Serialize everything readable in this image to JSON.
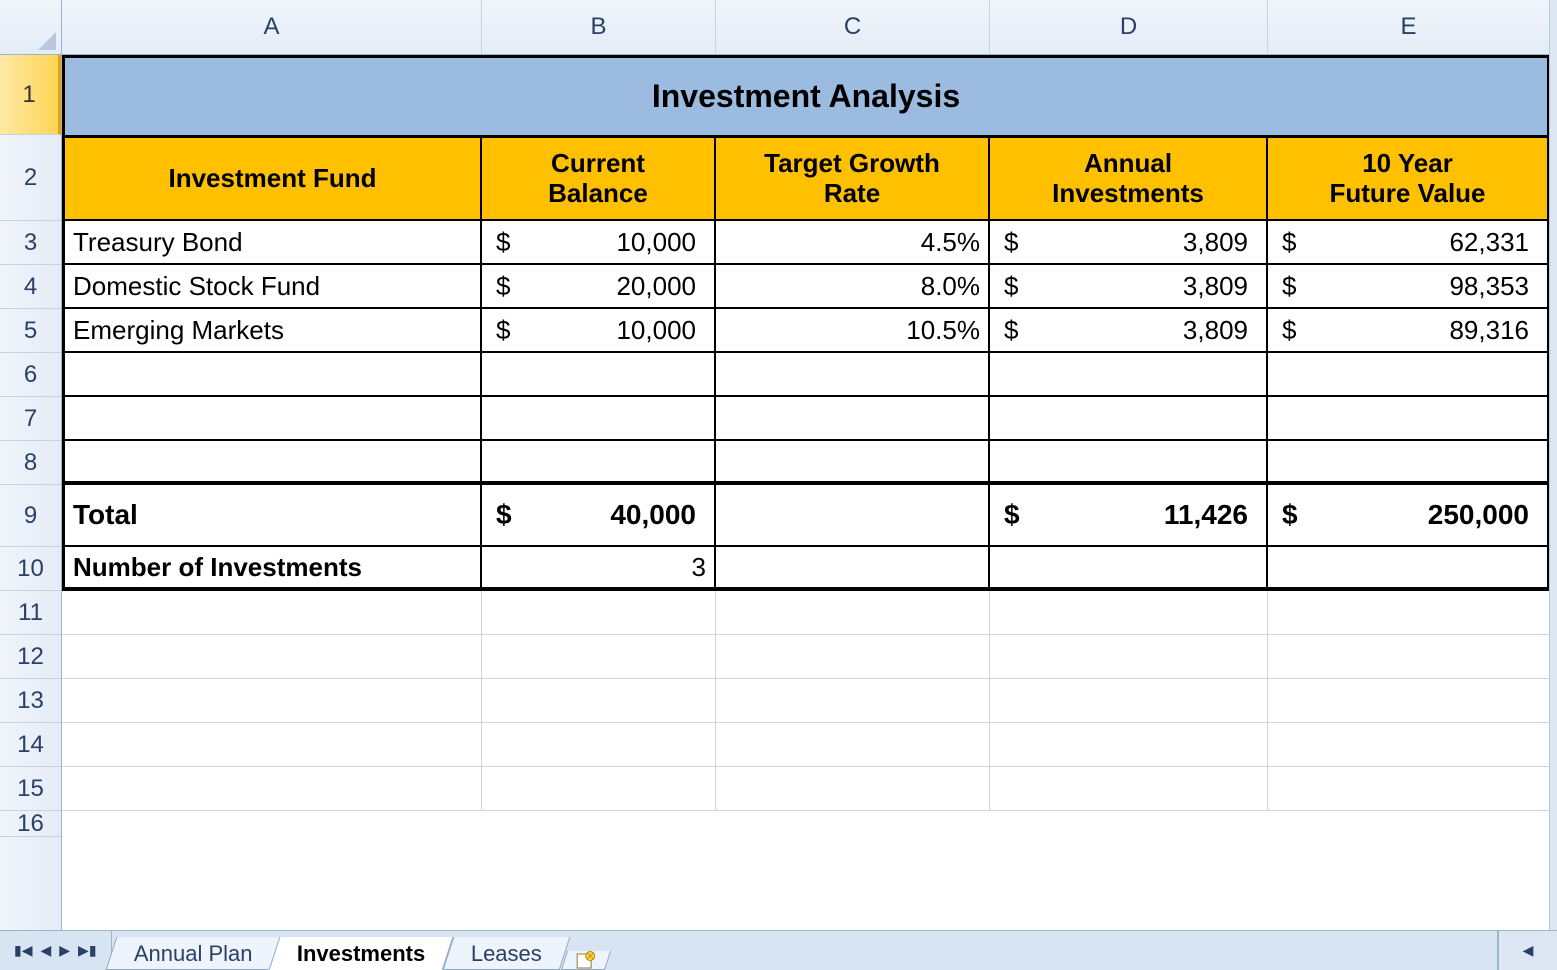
{
  "columns": [
    "A",
    "B",
    "C",
    "D",
    "E"
  ],
  "rows": [
    "1",
    "2",
    "3",
    "4",
    "5",
    "6",
    "7",
    "8",
    "9",
    "10",
    "11",
    "12",
    "13",
    "14",
    "15",
    "16"
  ],
  "selected_row": "1",
  "title": "Investment Analysis",
  "headers": {
    "fund": "Investment Fund",
    "balance_l1": "Current",
    "balance_l2": "Balance",
    "growth_l1": "Target Growth",
    "growth_l2": "Rate",
    "annual_l1": "Annual",
    "annual_l2": "Investments",
    "fv_l1": "10 Year",
    "fv_l2": "Future Value"
  },
  "data": [
    {
      "fund": "Treasury Bond",
      "balance": "10,000",
      "growth": "4.5%",
      "annual": "3,809",
      "fv": "62,331"
    },
    {
      "fund": "Domestic Stock Fund",
      "balance": "20,000",
      "growth": "8.0%",
      "annual": "3,809",
      "fv": "98,353"
    },
    {
      "fund": "Emerging Markets",
      "balance": "10,000",
      "growth": "10.5%",
      "annual": "3,809",
      "fv": "89,316"
    }
  ],
  "totals": {
    "label": "Total",
    "balance": "40,000",
    "annual": "11,426",
    "fv": "250,000"
  },
  "count": {
    "label": "Number of Investments",
    "value": "3"
  },
  "currency_symbol": "$",
  "tabs": [
    "Annual Plan",
    "Investments",
    "Leases"
  ],
  "active_tab": "Investments",
  "nav_icons": [
    "first",
    "prev",
    "next",
    "last"
  ]
}
